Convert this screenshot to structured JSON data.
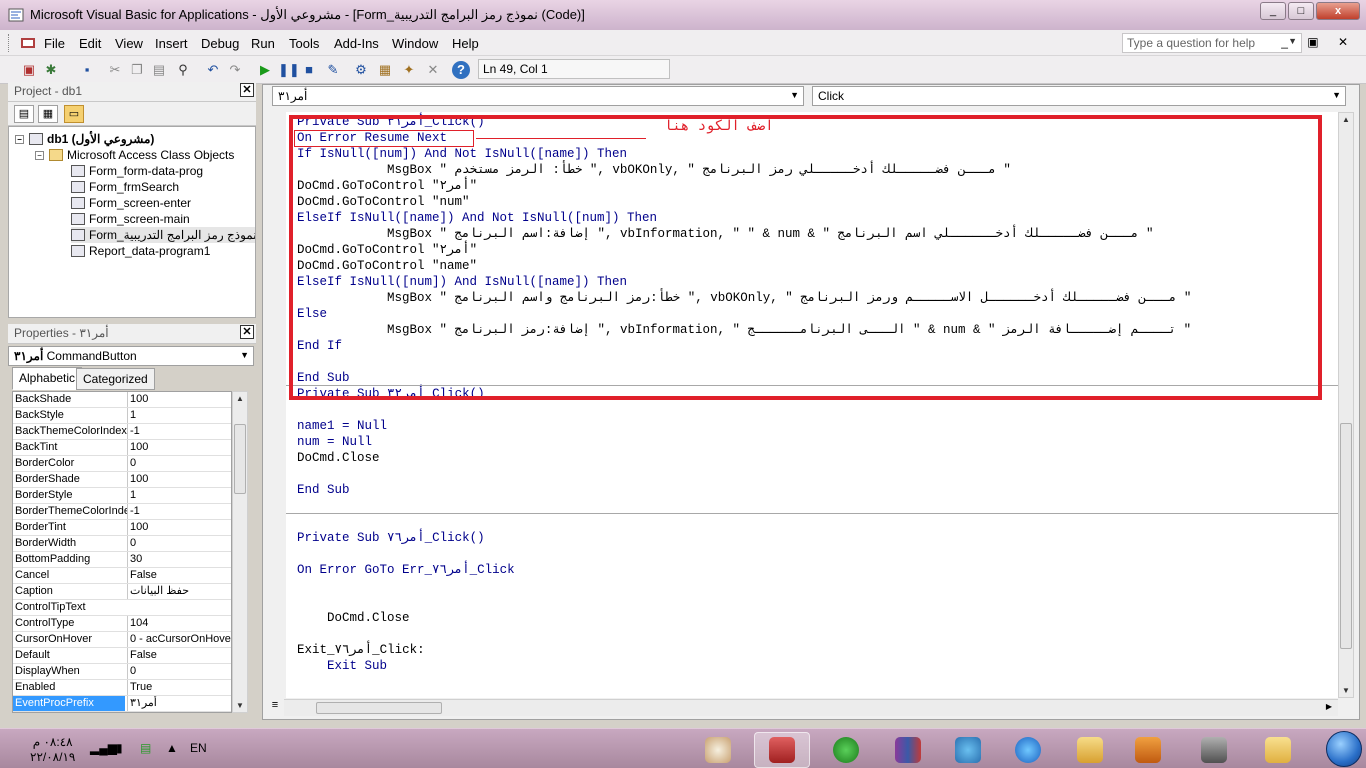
{
  "window": {
    "title": "Microsoft Visual Basic for Applications - مشروعي الأول - [Form_نموذج رمز البرامج التدريبية (Code)]",
    "controls": [
      "_",
      "□",
      "x"
    ]
  },
  "menu": {
    "items": [
      "File",
      "Edit",
      "View",
      "Insert",
      "Debug",
      "Run",
      "Tools",
      "Add-Ins",
      "Window",
      "Help"
    ],
    "help_placeholder": "Type a question for help"
  },
  "toolbar": {
    "position": "Ln 49, Col 1"
  },
  "project": {
    "header": "Project - db1",
    "root": "db1 (مشروعي الأول)",
    "folder": "Microsoft Access Class Objects",
    "items": [
      "Form_form-data-prog",
      "Form_frmSearch",
      "Form_screen-enter",
      "Form_screen-main",
      "Form_نموذج رمز البرامج التدريبية",
      "Report_data-program1"
    ]
  },
  "properties": {
    "header": "Properties - أمر٣١",
    "object_name": "أمر٣١",
    "object_type": "CommandButton",
    "tabs": [
      "Alphabetic",
      "Categorized"
    ],
    "rows": [
      {
        "name": "BackShade",
        "value": "100"
      },
      {
        "name": "BackStyle",
        "value": "1"
      },
      {
        "name": "BackThemeColorIndex",
        "value": "-1"
      },
      {
        "name": "BackTint",
        "value": "100"
      },
      {
        "name": "BorderColor",
        "value": "0"
      },
      {
        "name": "BorderShade",
        "value": "100"
      },
      {
        "name": "BorderStyle",
        "value": "1"
      },
      {
        "name": "BorderThemeColorInde",
        "value": "-1"
      },
      {
        "name": "BorderTint",
        "value": "100"
      },
      {
        "name": "BorderWidth",
        "value": "0"
      },
      {
        "name": "BottomPadding",
        "value": "30"
      },
      {
        "name": "Cancel",
        "value": "False"
      },
      {
        "name": "Caption",
        "value": "حفظ البيانات"
      },
      {
        "name": "ControlTipText",
        "value": ""
      },
      {
        "name": "ControlType",
        "value": "104"
      },
      {
        "name": "CursorOnHover",
        "value": "0 - acCursorOnHover"
      },
      {
        "name": "Default",
        "value": "False"
      },
      {
        "name": "DisplayWhen",
        "value": "0"
      },
      {
        "name": "Enabled",
        "value": "True"
      },
      {
        "name": "EventProcPrefix",
        "value": "أمر٣١"
      }
    ]
  },
  "code_window": {
    "object_combo": "أمر٣١",
    "proc_combo": "Click",
    "annotation": "اضف الكود هنا",
    "lines": [
      "Private Sub أمر٣١_Click()",
      "On Error Resume Next",
      "If IsNull([num]) And Not IsNull([name]) Then",
      "            MsgBox \" خطأ: الرمز مستخدم \", vbOKOnly, \" مـــن فضـــــلك أدخـــــلي رمز البرنامج \"",
      "DoCmd.GoToControl \"أمر٢\"",
      "DoCmd.GoToControl \"num\"",
      "ElseIf IsNull([name]) And Not IsNull([num]) Then",
      "            MsgBox \" إضافة:اسم البرنامج \", vbInformation, \" \" & num & \" مـــن فضـــــلك أدخــــــلي اسم البرنامج \"",
      "DoCmd.GoToControl \"أمر٢\"",
      "DoCmd.GoToControl \"name\"",
      "ElseIf IsNull([num]) And IsNull([name]) Then",
      "            MsgBox \" خطأ:رمز البرنامج واسم البرنامج \", vbOKOnly, \" مـــن فضـــــلك أدخــــــل الاســـــم ورمز البرنامج \"",
      "Else",
      "            MsgBox \" إضافة:رمز البرنامج \", vbInformation, \" الـــى البرنامــــــج \" & num & \" تــــم إضـــــافة الرمز \"",
      "End If",
      "",
      "End Sub",
      "Private Sub أمر٣٢_Click()",
      "",
      "name1 = Null",
      "num = Null",
      "DoCmd.Close",
      "",
      "End Sub",
      "",
      "",
      "Private Sub أمر٧٦_Click()",
      "",
      "On Error GoTo Err_أمر٧٦_Click",
      "",
      "",
      "    DoCmd.Close",
      "",
      "Exit_أمر٧٦_Click:",
      "    Exit Sub"
    ]
  },
  "taskbar": {
    "time": "٠٨:٤٨ م",
    "date": "٢٢/٠٨/١٩",
    "lang": "EN"
  },
  "colors": {
    "keyword": "#00008b",
    "highlight_box": "#e0202a",
    "selection": "#3399ff"
  }
}
